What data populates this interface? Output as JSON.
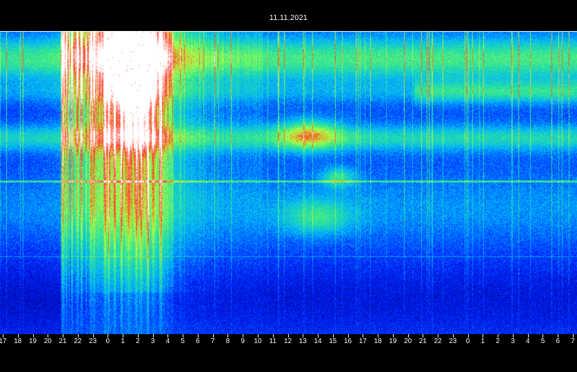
{
  "chart_data": {
    "type": "heatmap",
    "title": "11.11.2021",
    "xlabel": "",
    "ylabel": "",
    "x_tick_labels": [
      "17",
      "18",
      "19",
      "20",
      "21",
      "22",
      "23",
      "0",
      "1",
      "2",
      "3",
      "4",
      "5",
      "6",
      "7",
      "8",
      "9",
      "10",
      "11",
      "12",
      "13",
      "14",
      "15",
      "16",
      "17",
      "18",
      "19",
      "20",
      "21",
      "22",
      "23",
      "0",
      "1",
      "2",
      "3",
      "4",
      "5",
      "6",
      "7"
    ],
    "colormap": [
      "#00007a",
      "#0022ff",
      "#00b4ff",
      "#30e890",
      "#b8ff40",
      "#ff3020",
      "#ffffff"
    ],
    "grid": false,
    "legend": "none"
  }
}
